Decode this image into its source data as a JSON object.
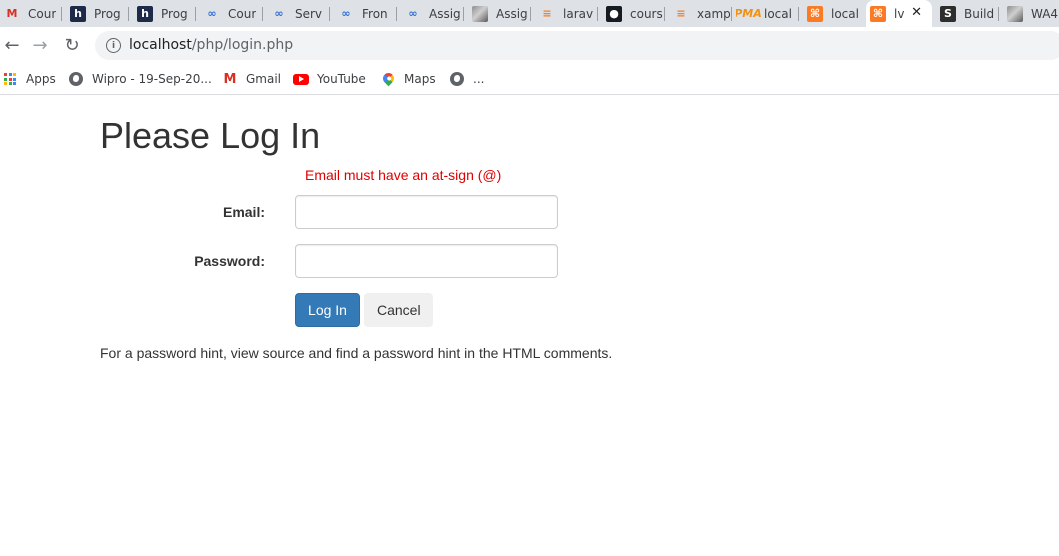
{
  "browser": {
    "tabs": [
      {
        "icon": "gmail-icon",
        "title": "Cour"
      },
      {
        "icon": "h-logo-icon",
        "title": "Prog"
      },
      {
        "icon": "h-logo-icon",
        "title": "Prog"
      },
      {
        "icon": "coursera-icon",
        "title": "Cour"
      },
      {
        "icon": "coursera-icon",
        "title": "Serv"
      },
      {
        "icon": "coursera-icon",
        "title": "Fron"
      },
      {
        "icon": "coursera-icon",
        "title": "Assig"
      },
      {
        "icon": "avatar-icon",
        "title": "Assig"
      },
      {
        "icon": "stackoverflow-icon",
        "title": "larav"
      },
      {
        "icon": "github-icon",
        "title": "cours"
      },
      {
        "icon": "stackoverflow-icon",
        "title": "xamp"
      },
      {
        "icon": "phpmyadmin-icon",
        "title": "local"
      },
      {
        "icon": "xampp-icon",
        "title": "local"
      },
      {
        "icon": "xampp-icon",
        "title": "lv",
        "active": true
      },
      {
        "icon": "dark-circle-icon",
        "title": "Build"
      },
      {
        "icon": "avatar-icon",
        "title": "WA4"
      }
    ],
    "nav": {
      "back": "←",
      "forward": "→",
      "reload": "↻"
    },
    "address": {
      "host": "localhost",
      "path": "/php/login.php"
    },
    "bookmarks": [
      {
        "icon": "apps-grid-icon",
        "label": "Apps"
      },
      {
        "icon": "globe-icon",
        "label": "Wipro - 19-Sep-20..."
      },
      {
        "icon": "gmail-icon",
        "label": "Gmail"
      },
      {
        "icon": "youtube-icon",
        "label": "YouTube"
      },
      {
        "icon": "maps-pin-icon",
        "label": "Maps"
      },
      {
        "icon": "globe-icon",
        "label": "..."
      }
    ]
  },
  "login": {
    "title": "Please Log In",
    "error": "Email must have an at-sign (@)",
    "email_label": "Email:",
    "email_value": "",
    "password_label": "Password:",
    "password_value": "",
    "login_button": "Log In",
    "cancel_button": "Cancel",
    "hint": "For a password hint, view source and find a password hint in the HTML comments."
  },
  "colors": {
    "error": "#e00000",
    "primary_button": "#337ab7",
    "default_button": "#f0f0f0",
    "tabstrip": "#dee1e6"
  }
}
